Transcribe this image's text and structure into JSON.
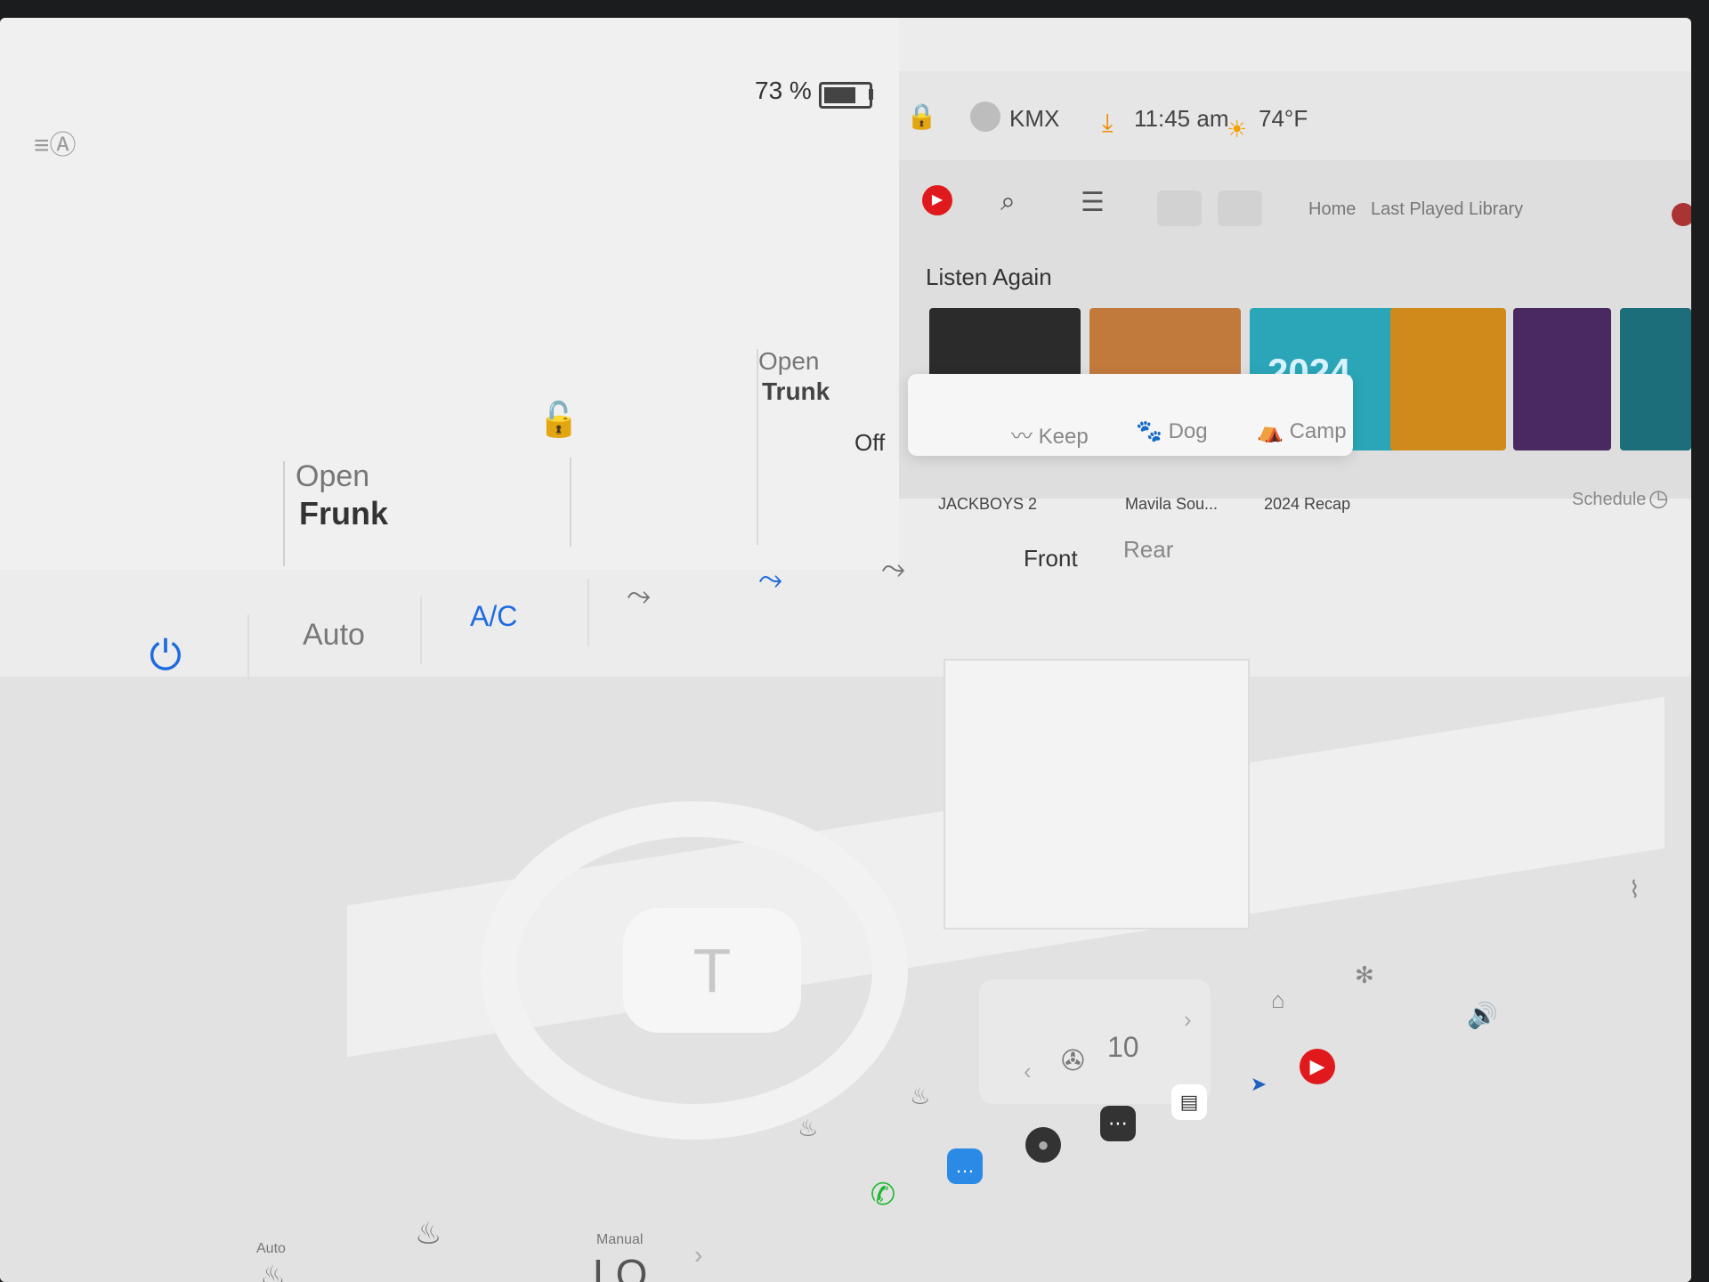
{
  "status": {
    "battery_percent": "73 %",
    "battery_level": 0.73,
    "user": "KMX",
    "time": "11:45 am",
    "temperature": "74°F"
  },
  "car": {
    "frunk_label": "Open",
    "frunk_action": "Frunk",
    "trunk_label": "Open",
    "trunk_action": "Trunk"
  },
  "modes": {
    "off_label": "Off",
    "items": [
      "Keep",
      "Dog",
      "Camp"
    ]
  },
  "climate": {
    "auto_label": "Auto",
    "ac_label": "A/C",
    "tabs": [
      "Front",
      "Rear"
    ],
    "schedule_label": "Schedule",
    "fan_speed": "10"
  },
  "music": {
    "nav": [
      "Home",
      "Last Played",
      "Library"
    ],
    "section_title": "Listen Again",
    "albums": [
      {
        "title": "JACKBOYS 2",
        "color": "#2b2b2b"
      },
      {
        "title": "Mavila Sou...",
        "color": "#c27a3c"
      },
      {
        "title": "2024 Recap",
        "color": "#2aa6b8"
      },
      {
        "title": "",
        "color": "#d08a1c"
      },
      {
        "title": "",
        "color": "#4a2860"
      },
      {
        "title": "",
        "color": "#1c6f7a"
      }
    ],
    "album_text_2024": "2024"
  },
  "seat": {
    "auto_label": "Auto"
  },
  "temp_control": {
    "mode": "Manual",
    "value": "LO"
  },
  "colors": {
    "accent_blue": "#1e6be0",
    "youtube_red": "#e0191c",
    "download_orange": "#f08a00"
  }
}
